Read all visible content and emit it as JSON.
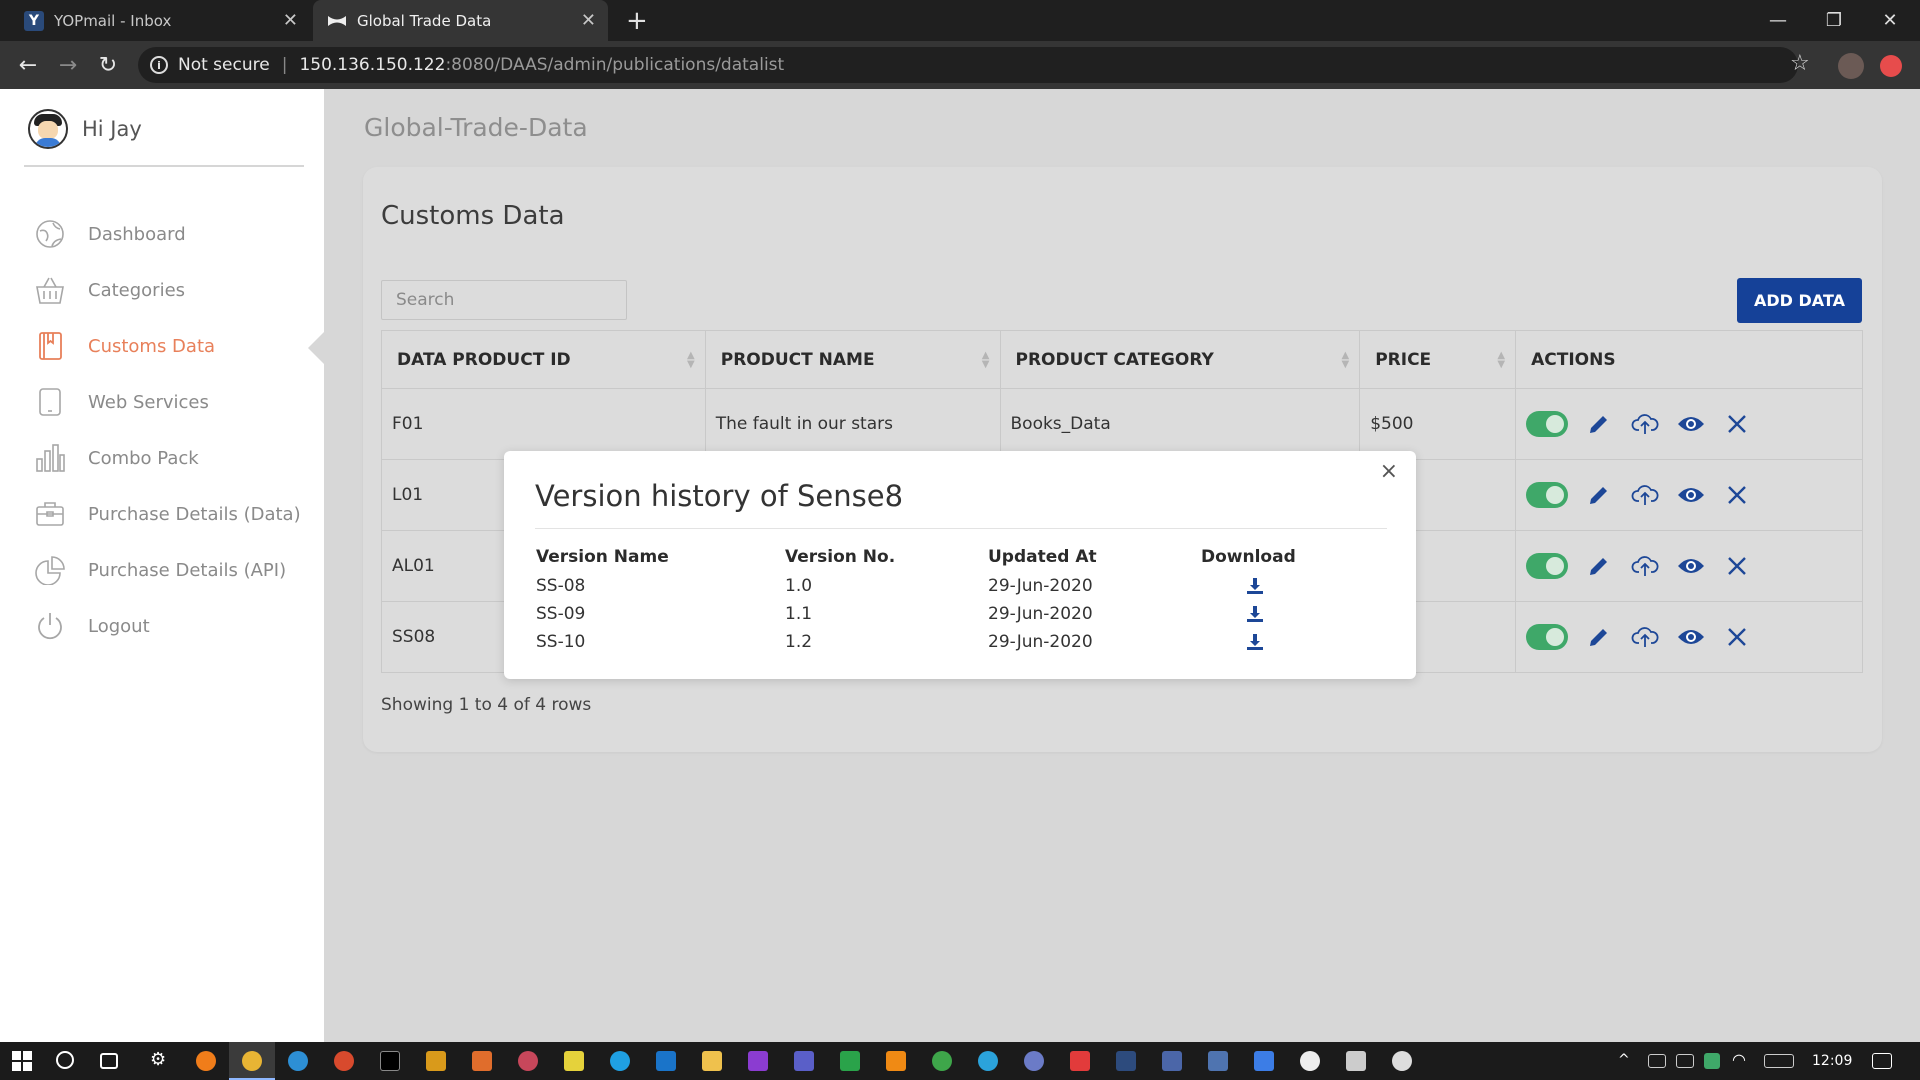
{
  "browser": {
    "tabs": [
      {
        "title": "YOPmail - Inbox",
        "favicon": "Y"
      },
      {
        "title": "Global Trade Data"
      }
    ],
    "not_secure": "Not secure",
    "url_host": "150.136.150.122",
    "url_path": ":8080/DAAS/admin/publications/datalist"
  },
  "sidebar": {
    "greeting": "Hi Jay",
    "items": [
      {
        "label": "Dashboard",
        "icon": "dashboard-icon"
      },
      {
        "label": "Categories",
        "icon": "basket-icon"
      },
      {
        "label": "Customs Data",
        "icon": "book-icon",
        "active": true
      },
      {
        "label": "Web Services",
        "icon": "mobile-icon"
      },
      {
        "label": "Combo Pack",
        "icon": "bar-chart-icon"
      },
      {
        "label": "Purchase Details (Data)",
        "icon": "briefcase-icon"
      },
      {
        "label": "Purchase Details (API)",
        "icon": "pie-chart-icon"
      },
      {
        "label": "Logout",
        "icon": "power-icon"
      }
    ]
  },
  "main": {
    "page_title": "Global-Trade-Data",
    "card_title": "Customs Data",
    "search_placeholder": "Search",
    "add_button": "ADD DATA",
    "columns": [
      "DATA PRODUCT ID",
      "PRODUCT NAME",
      "PRODUCT CATEGORY",
      "PRICE",
      "ACTIONS"
    ],
    "rows": [
      {
        "id": "F01",
        "name": "The fault in our stars",
        "category": "Books_Data",
        "price": "$500"
      },
      {
        "id": "L01",
        "name": "",
        "category": "",
        "price": ""
      },
      {
        "id": "AL01",
        "name": "",
        "category": "",
        "price": ""
      },
      {
        "id": "SS08",
        "name": "",
        "category": "",
        "price": ""
      }
    ],
    "footer": "Showing 1 to 4 of 4 rows"
  },
  "modal": {
    "title": "Version history of Sense8",
    "close": "×",
    "columns": [
      "Version Name",
      "Version No.",
      "Updated At",
      "Download"
    ],
    "rows": [
      {
        "name": "SS-08",
        "version": "1.0",
        "updated": "29-Jun-2020"
      },
      {
        "name": "SS-09",
        "version": "1.1",
        "updated": "29-Jun-2020"
      },
      {
        "name": "SS-10",
        "version": "1.2",
        "updated": "29-Jun-2020"
      }
    ]
  },
  "taskbar": {
    "time": "12:09"
  },
  "colors": {
    "accent": "#e8805a",
    "primary_button": "#154198",
    "toggle_on": "#3fa869",
    "icon_blue": "#1d4797"
  }
}
